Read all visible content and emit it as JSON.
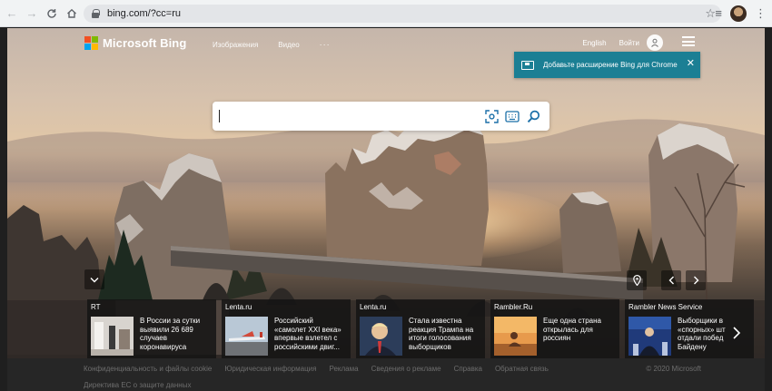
{
  "browser": {
    "url": "bing.com/?cc=ru"
  },
  "bing": {
    "brand": "Microsoft Bing",
    "nav": [
      "Изображения",
      "Видео",
      "···"
    ],
    "language": "English",
    "signin": "Войти",
    "colors": {
      "ms_red": "#f25022",
      "ms_green": "#7fba00",
      "ms_blue": "#00a4ef",
      "ms_yellow": "#ffb900",
      "banner": "#1b7f94"
    }
  },
  "extension_banner": {
    "text": "Добавьте расширение Bing для Chrome",
    "close": "✕"
  },
  "search": {
    "value": "",
    "icons": [
      "visual-search-icon",
      "keyboard-icon",
      "search-icon"
    ]
  },
  "news": [
    {
      "source": "RT",
      "headline": "В России за сутки выявили 26 689 случаев коронавируса"
    },
    {
      "source": "Lenta.ru",
      "headline": "Российский «самолет XXI века» впервые взлетел с российскими двиг..."
    },
    {
      "source": "Lenta.ru",
      "headline": "Стала известна реакция Трампа на итоги голосования выборщиков"
    },
    {
      "source": "Rambler.Ru",
      "headline": "Еще одна страна открылась для россиян"
    },
    {
      "source": "Rambler News Service",
      "headline": "Выборщики в «спорных» шт отдали побед Байдену"
    }
  ],
  "footer": {
    "links": [
      "Конфиденциальность и файлы cookie",
      "Юридическая информация",
      "Реклама",
      "Сведения о рекламе",
      "Справка",
      "Обратная связь"
    ],
    "copyright": "© 2020 Microsoft",
    "second_line": "Директива ЕС о защите данных"
  }
}
